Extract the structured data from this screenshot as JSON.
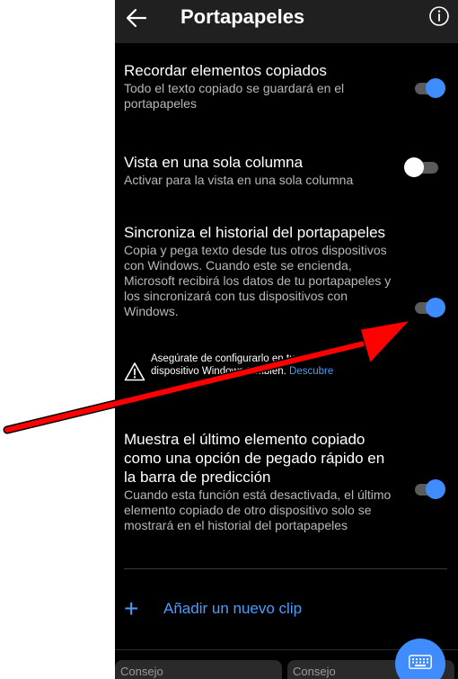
{
  "header": {
    "title": "Portapapeles",
    "back_icon": "arrow-left-icon",
    "info_icon": "info-circle-icon"
  },
  "settings": [
    {
      "title": "Recordar elementos copiados",
      "description": "Todo el texto copiado se guardará en el portapapeles",
      "enabled": true
    },
    {
      "title": "Vista en una sola columna",
      "description": "Activar para la vista en una sola columna",
      "enabled": false
    },
    {
      "title": "Sincroniza el historial del portapapeles",
      "description": "Copia y pega texto desde tus otros dispositivos con Windows. Cuando este se encienda, Microsoft recibirá los datos de tu portapapeles y los sincronizará con tus dispositivos con Windows.",
      "enabled": true
    },
    {
      "title": "Muestra el último elemento copiado como una opción de pegado rápido en la barra de predicción",
      "description": "Cuando esta función está desactivada, el último elemento copiado de otro dispositivo solo se mostrará en el historial del portapapeles",
      "enabled": true
    }
  ],
  "sync_note": {
    "text_line1": "Asegúrate de configurarlo en tu",
    "text_line2": "dispositivo Windows también.",
    "link": "Descubre"
  },
  "add_clip": {
    "icon": "plus-icon",
    "label": "Añadir un nuevo clip"
  },
  "tips": [
    {
      "label": "Consejo"
    },
    {
      "label": "Consejo"
    }
  ],
  "fab": {
    "icon": "keyboard-icon"
  },
  "annotation": {
    "color": "#ff0000",
    "icon": "red-arrow-annotation"
  },
  "colors": {
    "accent": "#3f8cff",
    "background": "#000000",
    "appbar": "#202020",
    "secondary_text": "#b8b8b8"
  }
}
